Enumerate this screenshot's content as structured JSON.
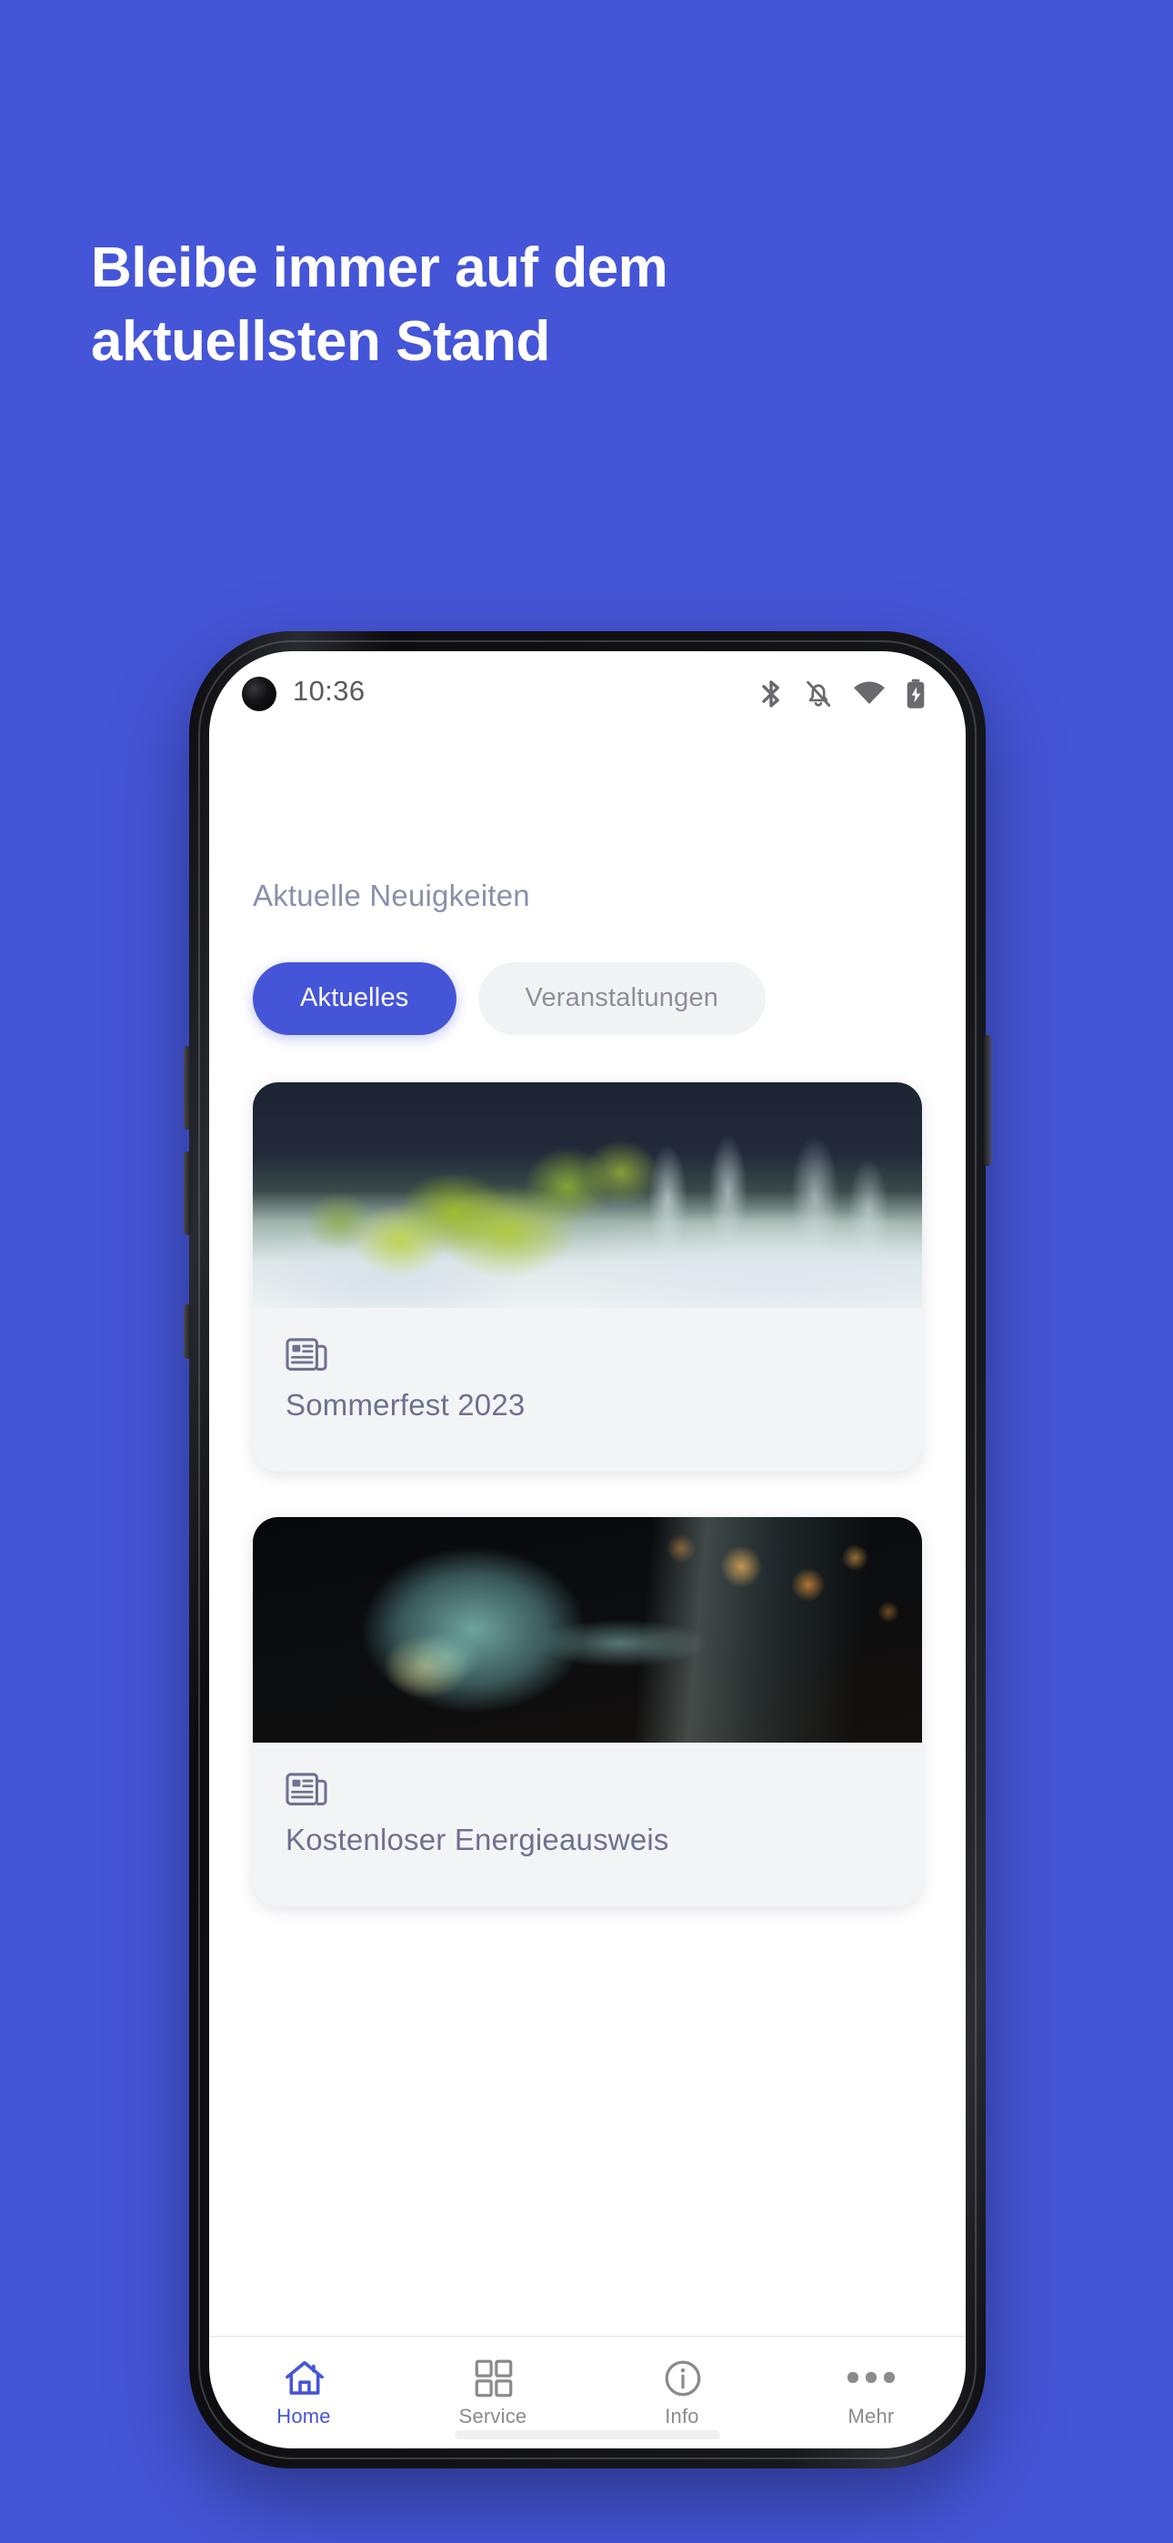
{
  "promo": {
    "headline": "Bleibe immer auf dem\naktuellsten Stand",
    "background_color": "#4555d8",
    "text_color": "#ffffff"
  },
  "phone": {
    "status_bar": {
      "time": "10:36",
      "icons": [
        "bluetooth-icon",
        "bell-off-icon",
        "wifi-icon",
        "battery-charging-icon"
      ]
    },
    "home_indicator": true
  },
  "app": {
    "section_title": "Aktuelle Neuigkeiten",
    "accent_color": "#4555d8",
    "tabs": [
      {
        "label": "Aktuelles",
        "active": true
      },
      {
        "label": "Veranstaltungen",
        "active": false
      }
    ],
    "news_cards": [
      {
        "title": "Sommerfest 2023",
        "icon": "newspaper-icon",
        "image_description": "festive table setting with green foliage and crystal glassware"
      },
      {
        "title": "Kostenloser Energieausweis",
        "icon": "newspaper-icon",
        "image_description": "incandescent light bulb glowing against dark background with orange bokeh"
      }
    ],
    "bottom_nav": [
      {
        "label": "Home",
        "icon": "home-icon",
        "active": true
      },
      {
        "label": "Service",
        "icon": "grid-icon",
        "active": false
      },
      {
        "label": "Info",
        "icon": "info-icon",
        "active": false
      },
      {
        "label": "Mehr",
        "icon": "ellipsis-icon",
        "active": false
      }
    ]
  }
}
